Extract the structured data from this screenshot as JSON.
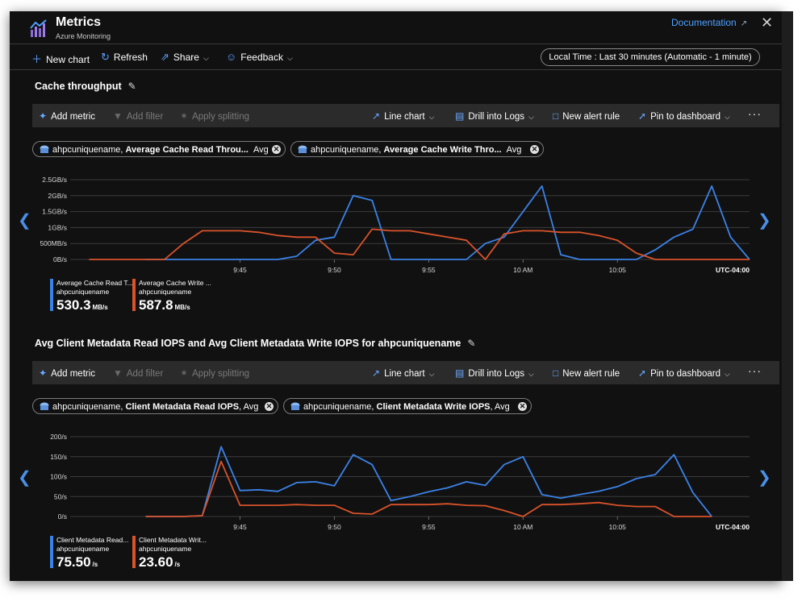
{
  "app": {
    "title": "Metrics",
    "subtitle": "Azure Monitoring",
    "documentation_link": "Documentation",
    "icon": "metrics-chart-icon"
  },
  "commands": [
    {
      "label": "New chart",
      "icon": "plus-icon"
    },
    {
      "label": "Refresh",
      "icon": "refresh-icon"
    },
    {
      "label": "Share",
      "icon": "share-icon"
    },
    {
      "label": "Feedback",
      "icon": "smile-icon"
    }
  ],
  "time_range": "Local Time : Last 30 minutes (Automatic - 1 minute)",
  "toolbar": {
    "add_metric": "Add metric",
    "add_filter": "Add filter",
    "apply_splitting": "Apply splitting",
    "line_chart": "Line chart",
    "drill_into_logs": "Drill into Logs",
    "new_alert_rule": "New alert rule",
    "pin_to_dashboard": "Pin to dashboard",
    "more": "···"
  },
  "colors": {
    "blue": "#3b82e6",
    "red": "#d9532b",
    "grid": "#3c3c3c",
    "axis_text": "#d8d8d8"
  },
  "charts": [
    {
      "title": "Cache throughput",
      "pills": [
        {
          "resource": "ahpcuniquename, ",
          "metric": "Average Cache Read Throu...",
          "agg": "Avg"
        },
        {
          "resource": "ahpcuniquename, ",
          "metric": "Average Cache Write Thro...",
          "agg": "Avg"
        }
      ],
      "legend": [
        {
          "name": "Average Cache Read T...",
          "resource": "ahpcuniquename",
          "value": "530.3",
          "unit": "MB/s",
          "color": "#3b82e6"
        },
        {
          "name": "Average Cache Write ...",
          "resource": "ahpcuniquename",
          "value": "587.8",
          "unit": "MB/s",
          "color": "#d9532b"
        }
      ]
    },
    {
      "title": "Avg Client Metadata Read IOPS and Avg Client Metadata Write IOPS for ahpcuniquename",
      "pills": [
        {
          "resource": "ahpcuniquename, ",
          "metric": "Client Metadata Read IOPS",
          "agg": ", Avg"
        },
        {
          "resource": "ahpcuniquename, ",
          "metric": "Client Metadata Write IOPS",
          "agg": ", Avg"
        }
      ],
      "legend": [
        {
          "name": "Client Metadata Read...",
          "resource": "ahpcuniquename",
          "value": "75.50",
          "unit": "/s",
          "color": "#3b82e6"
        },
        {
          "name": "Client Metadata Writ...",
          "resource": "ahpcuniquename",
          "value": "23.60",
          "unit": "/s",
          "color": "#d9532b"
        }
      ]
    }
  ],
  "chart_data": [
    {
      "type": "line",
      "title": "Cache throughput",
      "x_unit": "minutes",
      "x": [
        -7,
        -6,
        -5,
        -4,
        -3,
        -2,
        -1,
        0,
        1,
        2,
        3,
        4,
        5,
        6,
        7,
        8,
        9,
        10,
        11,
        12,
        13,
        14,
        15,
        16,
        17,
        18,
        19,
        20,
        21,
        22,
        23,
        24,
        25,
        26,
        27,
        28,
        29
      ],
      "x_ticks": [
        "9:45",
        "9:50",
        "9:55",
        "10 AM",
        "10:05"
      ],
      "x_tick_pos": [
        2,
        7,
        12,
        17,
        22
      ],
      "timezone": "UTC-04:00",
      "y_ticks": [
        "0B/s",
        "500MB/s",
        "1GB/s",
        "1.5GB/s",
        "2GB/s",
        "2.5GB/s"
      ],
      "y_tick_values": [
        0,
        0.5,
        1,
        1.5,
        2,
        2.5
      ],
      "y_unit": "GB/s",
      "ylim": [
        0,
        2.5
      ],
      "grid": true,
      "series": [
        {
          "name": "Average Cache Read T...",
          "color": "#3b82e6",
          "values": [
            null,
            null,
            null,
            null,
            0,
            0,
            0,
            0,
            0,
            0,
            0,
            0,
            0.1,
            0.6,
            0.7,
            2.0,
            1.85,
            0,
            0,
            0,
            0,
            0,
            0.5,
            0.7,
            1.5,
            2.3,
            0.15,
            0,
            0,
            0,
            0,
            0.3,
            0.7,
            0.95,
            2.3,
            0.7,
            0,
            null,
            null
          ]
        },
        {
          "name": "Average Cache Write ...",
          "color": "#d9532b",
          "values": [
            null,
            0,
            0,
            0,
            0,
            0,
            0.5,
            0.9,
            0.9,
            0.9,
            0.85,
            0.75,
            0.7,
            0.7,
            0.2,
            0.15,
            0.95,
            0.9,
            0.9,
            0.8,
            0.7,
            0.6,
            0,
            0.8,
            0.9,
            0.9,
            0.85,
            0.85,
            0.75,
            0.6,
            0.2,
            0,
            0,
            0,
            0,
            0,
            0,
            null,
            null
          ]
        }
      ]
    },
    {
      "type": "line",
      "title": "Avg Client Metadata Read IOPS and Avg Client Metadata Write IOPS for ahpcuniquename",
      "x_unit": "minutes",
      "x": [
        -7,
        -6,
        -5,
        -4,
        -3,
        -2,
        -1,
        0,
        1,
        2,
        3,
        4,
        5,
        6,
        7,
        8,
        9,
        10,
        11,
        12,
        13,
        14,
        15,
        16,
        17,
        18,
        19,
        20,
        21,
        22,
        23,
        24,
        25,
        26,
        27,
        28,
        29
      ],
      "x_ticks": [
        "9:45",
        "9:50",
        "9:55",
        "10 AM",
        "10:05"
      ],
      "x_tick_pos": [
        2,
        7,
        12,
        17,
        22
      ],
      "timezone": "UTC-04:00",
      "y_ticks": [
        "0/s",
        "50/s",
        "100/s",
        "150/s",
        "200/s"
      ],
      "y_tick_values": [
        0,
        50,
        100,
        150,
        200
      ],
      "y_unit": "/s",
      "ylim": [
        0,
        200
      ],
      "grid": true,
      "series": [
        {
          "name": "Client Metadata Read...",
          "color": "#3b82e6",
          "values": [
            null,
            null,
            null,
            null,
            0,
            0,
            0,
            2,
            175,
            65,
            67,
            63,
            85,
            87,
            77,
            155,
            130,
            40,
            50,
            62,
            72,
            87,
            78,
            130,
            150,
            55,
            46,
            55,
            63,
            75,
            95,
            105,
            155,
            60,
            0,
            null,
            null
          ]
        },
        {
          "name": "Client Metadata Writ...",
          "color": "#d9532b",
          "values": [
            null,
            null,
            null,
            null,
            0,
            0,
            0,
            2,
            138,
            28,
            28,
            28,
            30,
            28,
            28,
            8,
            6,
            30,
            30,
            30,
            32,
            28,
            27,
            15,
            0,
            30,
            30,
            32,
            35,
            28,
            25,
            25,
            0,
            0,
            0,
            null,
            null
          ]
        }
      ]
    }
  ]
}
